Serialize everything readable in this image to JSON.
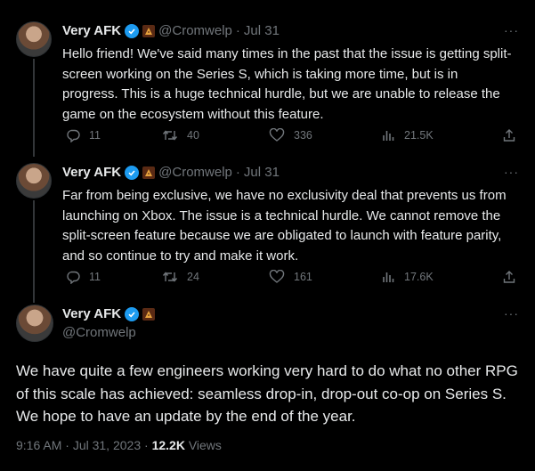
{
  "tweets": [
    {
      "name": "Very AFK",
      "handle": "@Cromwelp",
      "separator": "·",
      "date": "Jul 31",
      "text": "Hello friend! We've said many times in the past that the issue is getting split-screen working on the Series S, which is taking more time, but is in progress. This is a huge technical hurdle, but we are unable to release the game on the ecosystem without this feature.",
      "replies": "11",
      "retweets": "40",
      "likes": "336",
      "views": "21.5K"
    },
    {
      "name": "Very AFK",
      "handle": "@Cromwelp",
      "separator": "·",
      "date": "Jul 31",
      "text": "Far from being exclusive, we have no exclusivity deal that prevents us from launching on Xbox. The issue is a technical hurdle. We cannot remove the split-screen feature because we are obligated to launch with feature parity, and so continue to try and make it work.",
      "replies": "11",
      "retweets": "24",
      "likes": "161",
      "views": "17.6K"
    }
  ],
  "main": {
    "name": "Very AFK",
    "handle": "@Cromwelp",
    "text": "We have quite a few engineers working very hard to do what no other RPG of this scale has achieved: seamless drop-in, drop-out co-op on Series S. We hope to have an update by the end of the year.",
    "time": "9:16 AM",
    "separator": "·",
    "date": "Jul 31, 2023",
    "views_count": "12.2K",
    "views_label": "Views"
  },
  "more_label": "···",
  "colors": {
    "accent": "#1d9bf0",
    "muted": "#71767b",
    "text": "#e7e9ea",
    "bg": "#000000"
  },
  "icons": [
    "verified-icon",
    "affiliate-badge-icon",
    "reply-icon",
    "retweet-icon",
    "like-icon",
    "views-icon",
    "share-icon",
    "more-icon"
  ]
}
